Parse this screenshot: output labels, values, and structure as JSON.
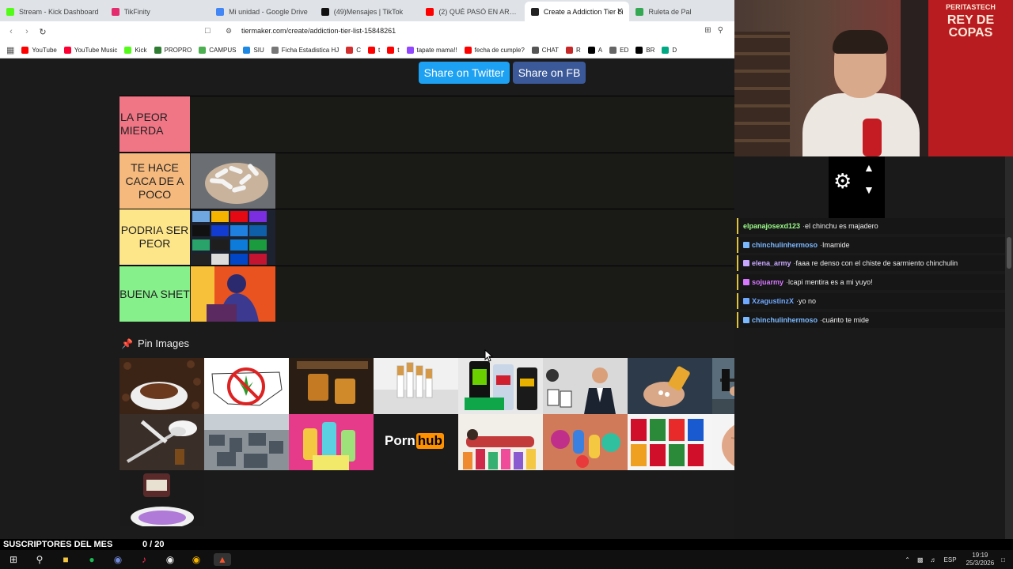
{
  "browser": {
    "tabs": [
      {
        "title": "Stream - Kick Dashboard",
        "color": "#53fc18",
        "active": false
      },
      {
        "title": "TikFinity",
        "color": "#e32b6d",
        "active": false
      },
      {
        "title": "Mi unidad - Google Drive",
        "color": "#4285f4",
        "active": false
      },
      {
        "title": "(49)Mensajes | TikTok",
        "color": "#111111",
        "active": false
      },
      {
        "title": "(2) QUÉ PASÓ EN ARGENTINA",
        "color": "#ff0000",
        "active": false
      },
      {
        "title": "Create a Addiction Tier Li",
        "color": "#222222",
        "active": true
      },
      {
        "title": "Ruleta de Pal",
        "color": "#34a853",
        "active": false
      }
    ],
    "url": "tiermaker.com/create/addiction-tier-list-15848261",
    "bookmarks": [
      {
        "label": "YouTube",
        "color": "#ff0000"
      },
      {
        "label": "YouTube Music",
        "color": "#ff0033"
      },
      {
        "label": "Kick",
        "color": "#53fc18"
      },
      {
        "label": "PROPRO",
        "color": "#2e7d32"
      },
      {
        "label": "CAMPUS",
        "color": "#4caf50"
      },
      {
        "label": "SIU",
        "color": "#1e88e5"
      },
      {
        "label": "Ficha Estadistica HJ",
        "color": "#777777"
      },
      {
        "label": "C",
        "color": "#d32f2f"
      },
      {
        "label": "t",
        "color": "#ff0000"
      },
      {
        "label": "t",
        "color": "#ff0000"
      },
      {
        "label": "tapate mama!!",
        "color": "#9146ff"
      },
      {
        "label": "fecha de cumple?",
        "color": "#ff0000"
      },
      {
        "label": "CHAT",
        "color": "#555555"
      },
      {
        "label": "R",
        "color": "#c62828"
      },
      {
        "label": "A",
        "color": "#000000"
      },
      {
        "label": "ED",
        "color": "#666666"
      },
      {
        "label": "BR",
        "color": "#000000"
      },
      {
        "label": "D",
        "color": "#00a884"
      }
    ]
  },
  "page": {
    "share_twitter": "Share on Twitter",
    "share_fb": "Share on FB",
    "tiers": [
      {
        "label": "LA PEOR MIERDA",
        "color": "#f07585",
        "items": []
      },
      {
        "label": "TE HACE CACA DE A POCO",
        "color": "#f5b97d",
        "items": [
          "cigarette-filters"
        ]
      },
      {
        "label": "PODRIA SER PEOR",
        "color": "#fde68a",
        "items": [
          "streaming-apps"
        ]
      },
      {
        "label": "BUENA SHET",
        "color": "#86f08a",
        "items": [
          "gamer"
        ]
      }
    ],
    "pin_images": "Pin Images",
    "pool": [
      "coffee",
      "no-weed-map",
      "whisky",
      "cigarettes",
      "energy-drinks",
      "gambling",
      "pills",
      "gym",
      "donuts",
      "drugs-spoon",
      "hoarding",
      "vapes",
      "pornhub-logo",
      "lying-person",
      "candy",
      "soda-cans",
      "belly",
      "balloons",
      "purple-drink"
    ],
    "pornhub": {
      "porn": "Porn",
      "hub": "hub"
    }
  },
  "overlay": {
    "chat": [
      {
        "user": "elpanajosexd123",
        "color": "#9cff8a",
        "msg": "el chinchu es majadero"
      },
      {
        "user": "chinchulinhermoso",
        "color": "#7ab8ff",
        "msg": "Imamide"
      },
      {
        "user": "elena_army",
        "color": "#c7a7ff",
        "msg": "faaa re denso con el chiste de sarmiento chinchulin"
      },
      {
        "user": "sojuarmy",
        "color": "#d776ff",
        "msg": "lcapi mentira es a mi yuyo!"
      },
      {
        "user": "XzagustinzX",
        "color": "#6fa8ff",
        "msg": "yo no"
      },
      {
        "user": "chinchulinhermoso",
        "color": "#7ab8ff",
        "msg": "cuánto te mide"
      }
    ],
    "banner_top": "PERITASTECH",
    "banner_text": "REY DE COPAS",
    "subs_label": "SUSCRIPTORES DEL MES",
    "subs_count": "0 / 20"
  },
  "taskbar": {
    "lang": "ESP",
    "time": "19:19",
    "date": "25/3/2026"
  }
}
